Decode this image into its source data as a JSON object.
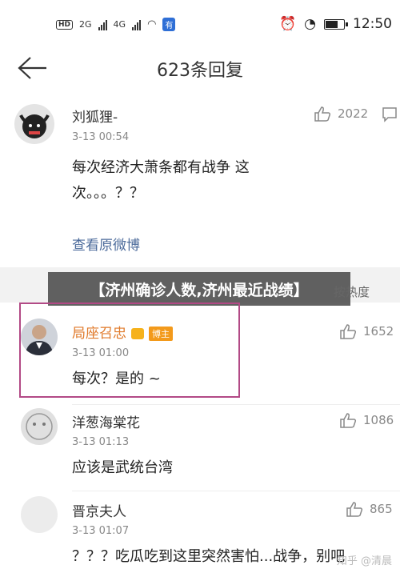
{
  "status_bar": {
    "time": "12:50",
    "hd": "HD",
    "net1": "2G",
    "net2": "4G"
  },
  "navbar": {
    "title": "623条回复"
  },
  "top_comment": {
    "name": "刘狐狸-",
    "time": "3-13 00:54",
    "likes": "2022",
    "text_line1": "每次经济大萧条都有战争 这",
    "text_line2": "次。。。？？",
    "view_original": "查看原微博"
  },
  "overlay": {
    "banner": "【济州确诊人数,济州最近战绩】",
    "sort": "按热度"
  },
  "replies": [
    {
      "name": "局座召忠",
      "badge": "博主",
      "time": "3-13 01:00",
      "text": "每次？是的 ~",
      "likes": "1652"
    },
    {
      "name": "洋葱海棠花",
      "time": "3-13 01:13",
      "text": "应该是武统台湾",
      "likes": "1086"
    },
    {
      "name": "晋京夫人",
      "time": "3-13 01:07",
      "text": "？？？吃瓜吃到这里突然害怕...战争，别吧",
      "likes": "865"
    }
  ],
  "watermark": "知乎 @清晨",
  "colors": {
    "highlight_border": "#b24a86",
    "link": "#4c6b9b",
    "vip_name": "#e07a2a",
    "badge": "#f39a1b"
  }
}
